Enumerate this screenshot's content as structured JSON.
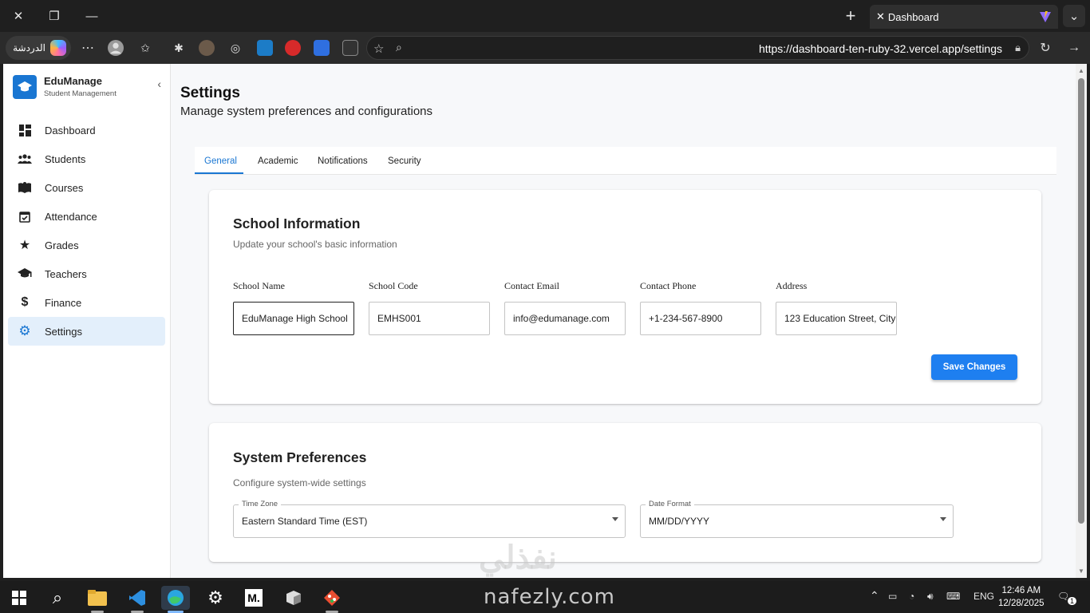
{
  "browser": {
    "tab_title": "Dashboard",
    "copilot_label": "الدردشة",
    "url": "https://dashboard-ten-ruby-32.vercel.app/settings"
  },
  "sidebar": {
    "brand_name": "EduManage",
    "brand_sub": "Student Management",
    "items": [
      {
        "label": "Dashboard",
        "icon": "dashboard-icon"
      },
      {
        "label": "Students",
        "icon": "people-icon"
      },
      {
        "label": "Courses",
        "icon": "book-icon"
      },
      {
        "label": "Attendance",
        "icon": "calendar-check-icon"
      },
      {
        "label": "Grades",
        "icon": "star-icon"
      },
      {
        "label": "Teachers",
        "icon": "teacher-icon"
      },
      {
        "label": "Finance",
        "icon": "dollar-icon"
      },
      {
        "label": "Settings",
        "icon": "gear-icon",
        "active": true
      }
    ]
  },
  "page": {
    "title": "Settings",
    "subtitle": "Manage system preferences and configurations"
  },
  "tabs": [
    {
      "label": "General",
      "active": true
    },
    {
      "label": "Academic"
    },
    {
      "label": "Notifications"
    },
    {
      "label": "Security"
    }
  ],
  "school_info": {
    "title": "School Information",
    "subtitle": "Update your school's basic information",
    "fields": [
      {
        "label": "School Name",
        "value": "EduManage High School"
      },
      {
        "label": "School Code",
        "value": "EMHS001"
      },
      {
        "label": "Contact Email",
        "value": "info@edumanage.com"
      },
      {
        "label": "Contact Phone",
        "value": "+1-234-567-8900"
      },
      {
        "label": "Address",
        "value": "123 Education Street, City"
      }
    ],
    "save_label": "Save Changes"
  },
  "system_prefs": {
    "title": "System Preferences",
    "subtitle": "Configure system-wide settings",
    "timezone_label": "Time Zone",
    "timezone_value": "Eastern Standard Time (EST)",
    "date_format_label": "Date Format",
    "date_format_value": "MM/DD/YYYY"
  },
  "watermark": {
    "arabic": "نفذلي",
    "latin": "nafezly.com"
  },
  "taskbar": {
    "lang": "ENG",
    "time": "12:46 AM",
    "date": "12/28/2025",
    "notifications": "1"
  },
  "colors": {
    "primary": "#1976d2",
    "save_button": "#1e7ff0",
    "active_nav_bg": "#e3effb"
  }
}
